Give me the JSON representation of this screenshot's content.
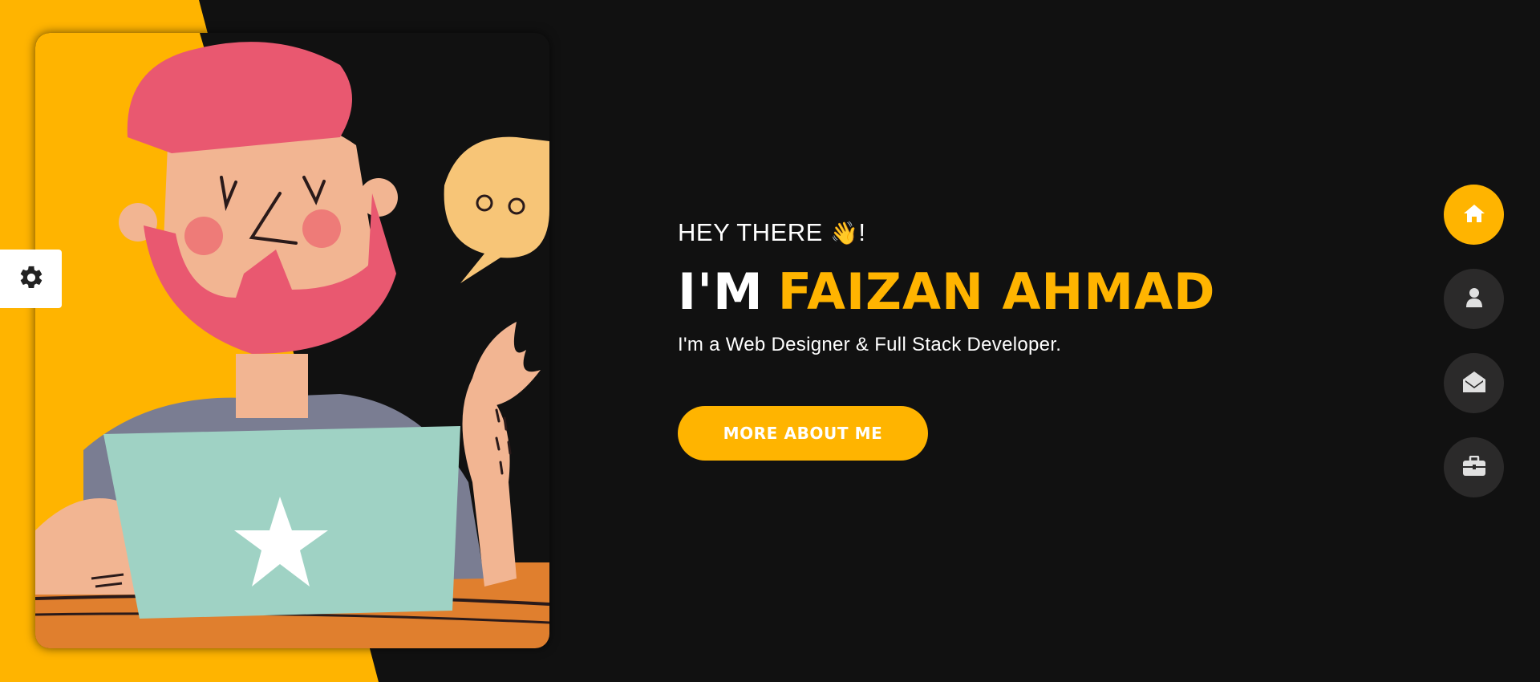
{
  "colors": {
    "accent": "#ffb400",
    "background": "#111111",
    "nav_inactive": "#2b2a2a",
    "icon_light": "#ffffff",
    "icon_muted": "#e0e0e0"
  },
  "settings": {
    "icon": "gear-icon"
  },
  "portrait": {
    "subject": "illustration"
  },
  "hero": {
    "greeting": "HEY THERE",
    "greeting_emoji": "👋",
    "greeting_suffix": "!",
    "name_prefix": "I'M",
    "name_highlight": "FAIZAN AHMAD",
    "tagline": "I'm a Web Designer & Full Stack Developer.",
    "cta_label": "MORE ABOUT ME"
  },
  "nav": [
    {
      "name": "home",
      "icon": "home-icon",
      "active": true
    },
    {
      "name": "about",
      "icon": "user-icon",
      "active": false
    },
    {
      "name": "contact",
      "icon": "envelope-open-icon",
      "active": false
    },
    {
      "name": "portfolio",
      "icon": "briefcase-icon",
      "active": false
    }
  ]
}
